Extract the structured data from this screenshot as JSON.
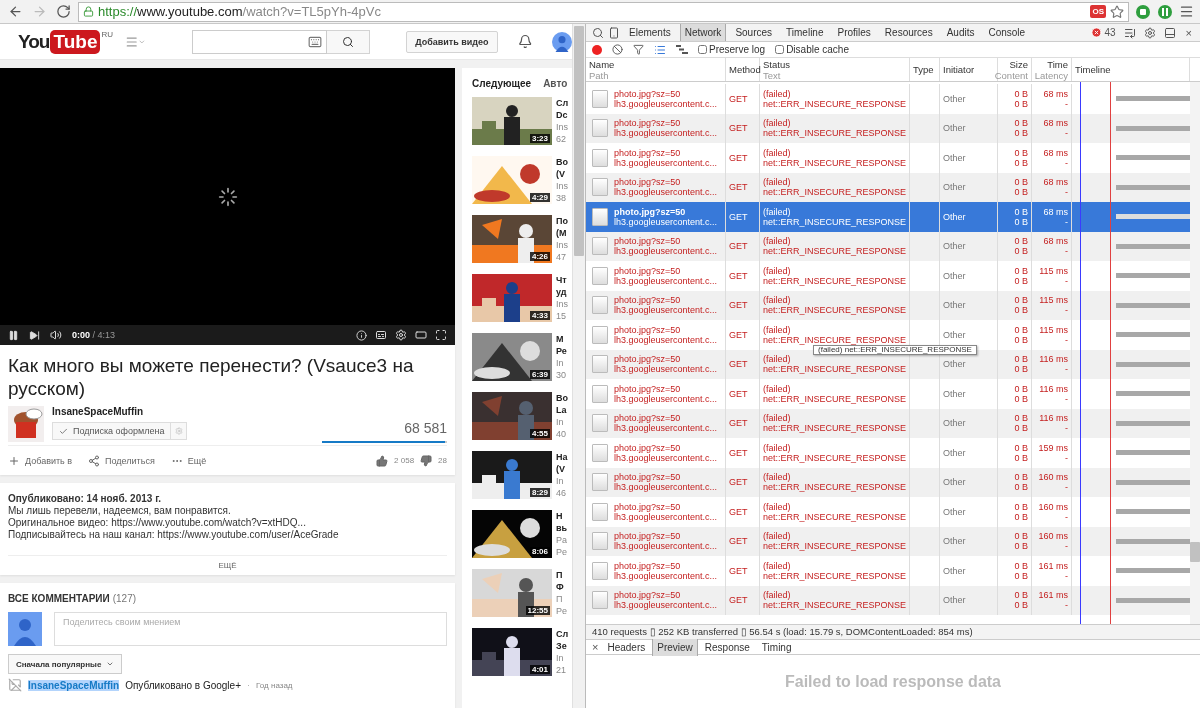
{
  "browser": {
    "nav": [
      {
        "kind": "back",
        "disabled": false
      },
      {
        "kind": "forward",
        "disabled": true
      },
      {
        "kind": "reload",
        "disabled": false
      }
    ],
    "url": {
      "scheme": "https://",
      "host": "www.youtube.com",
      "path": "/watch?v=TL5pYh-4pVc"
    },
    "extension_badge": "OS"
  },
  "youtube": {
    "logo": {
      "you": "You",
      "tube": "Tube",
      "region": "RU"
    },
    "upload_button": "Добавить видео",
    "player": {
      "loading": true,
      "time_current": "0:00",
      "time_rest": "/ 4:13"
    },
    "video": {
      "title": "Как много вы можете перенести? (Vsauce3 на русском)",
      "channel": "InsaneSpaceMuffin",
      "subscribe": {
        "label": "Подписка оформлена",
        "subscribed": true
      },
      "views": "68 581",
      "rating": {
        "level": 0.98
      },
      "actions": [
        {
          "kind": "add",
          "label": "Добавить в"
        },
        {
          "kind": "share",
          "label": "Поделиться"
        },
        {
          "kind": "more",
          "label": "Ещё"
        }
      ],
      "likes": "2 058",
      "dislikes": "28"
    },
    "description": {
      "published": "Опубликовано: 14 нояб. 2013 г.",
      "lines": [
        "Мы лишь перевели, надеемся, вам понравится.",
        "Оригинальное видео: https://www.youtube.com/watch?v=xtHDQ...",
        "Подписывайтесь на наш канал: https://www.youtube.com/user/AceGrade"
      ],
      "more": "ЕЩЁ"
    },
    "comments": {
      "heading": "ВСЕ КОММЕНТАРИИ",
      "count": "(127)",
      "placeholder": "Поделитесь своим мнением",
      "sort": "Сначала популярные",
      "items": [
        {
          "author": "InsaneSpaceMuffin",
          "author_highlighted": true,
          "source": "Опубликовано в Google+",
          "separator": "·",
          "time": "Год назад"
        }
      ]
    },
    "sidebar": {
      "heading": "Следующее",
      "autoplay": "Авто",
      "items": [
        {
          "duration": "3:23",
          "title": [
            "Сл",
            "Dc"
          ],
          "channel": "Ins",
          "views": "62"
        },
        {
          "duration": "4:29",
          "title": [
            "Во",
            "(V"
          ],
          "channel": "Ins",
          "views": "38"
        },
        {
          "duration": "4:26",
          "title": [
            "По",
            "(M"
          ],
          "channel": "Ins",
          "views": "47"
        },
        {
          "duration": "4:33",
          "title": [
            "Чт",
            "уд"
          ],
          "channel": "Ins",
          "views": "15"
        },
        {
          "duration": "6:39",
          "title": [
            "М",
            "Ре"
          ],
          "channel": "In",
          "views": "30"
        },
        {
          "duration": "4:55",
          "title": [
            "Во",
            "La"
          ],
          "channel": "In",
          "views": "40"
        },
        {
          "duration": "8:29",
          "title": [
            "На",
            "(V"
          ],
          "channel": "In",
          "views": "46"
        },
        {
          "duration": "8:06",
          "title": [
            "Н",
            "вь"
          ],
          "channel": "Pa",
          "views": "Pe"
        },
        {
          "duration": "12:55",
          "title": [
            "П",
            "Ф"
          ],
          "channel": "П",
          "views": "Pe"
        },
        {
          "duration": "4:01",
          "title": [
            "Сл",
            "Зе"
          ],
          "channel": "In",
          "views": "21"
        }
      ]
    }
  },
  "devtools": {
    "tabs": [
      {
        "label": "Elements",
        "selected": false
      },
      {
        "label": "Network",
        "selected": true
      },
      {
        "label": "Sources",
        "selected": false
      },
      {
        "label": "Timeline",
        "selected": false
      },
      {
        "label": "Profiles",
        "selected": false
      },
      {
        "label": "Resources",
        "selected": false
      },
      {
        "label": "Audits",
        "selected": false
      },
      {
        "label": "Console",
        "selected": false
      }
    ],
    "error_count": "43",
    "close": "×",
    "toolbar": {
      "recording": true,
      "list_view": true,
      "checkboxes": [
        {
          "label": "Preserve log",
          "checked": false
        },
        {
          "label": "Disable cache",
          "checked": false
        }
      ]
    },
    "columns": [
      {
        "title": "Name",
        "subtitle": "Path"
      },
      {
        "title": "Method"
      },
      {
        "title": "Status",
        "subtitle": "Text"
      },
      {
        "title": "Type"
      },
      {
        "title": "Initiator"
      },
      {
        "title": "Size",
        "subtitle": "Content"
      },
      {
        "title": "Time",
        "subtitle": "Latency"
      },
      {
        "title": "Timeline"
      }
    ],
    "rows": [
      {
        "name": "photo.jpg?sz=50",
        "path": "lh3.googleusercontent.c...",
        "method": "GET",
        "status": "(failed)",
        "status_text": "net::ERR_INSECURE_RESPONSE",
        "initiator": "Other",
        "size": "0 B",
        "content": "0 B",
        "time": "68 ms",
        "latency": "-",
        "failed": true,
        "selected": false
      },
      {
        "name": "photo.jpg?sz=50",
        "path": "lh3.googleusercontent.c...",
        "method": "GET",
        "status": "(failed)",
        "status_text": "net::ERR_INSECURE_RESPONSE",
        "initiator": "Other",
        "size": "0 B",
        "content": "0 B",
        "time": "68 ms",
        "latency": "-",
        "failed": true,
        "selected": false
      },
      {
        "name": "photo.jpg?sz=50",
        "path": "lh3.googleusercontent.c...",
        "method": "GET",
        "status": "(failed)",
        "status_text": "net::ERR_INSECURE_RESPONSE",
        "initiator": "Other",
        "size": "0 B",
        "content": "0 B",
        "time": "68 ms",
        "latency": "-",
        "failed": true,
        "selected": false
      },
      {
        "name": "photo.jpg?sz=50",
        "path": "lh3.googleusercontent.c...",
        "method": "GET",
        "status": "(failed)",
        "status_text": "net::ERR_INSECURE_RESPONSE",
        "initiator": "Other",
        "size": "0 B",
        "content": "0 B",
        "time": "68 ms",
        "latency": "-",
        "failed": true,
        "selected": false
      },
      {
        "name": "photo.jpg?sz=50",
        "path": "lh3.googleusercontent.c...",
        "method": "GET",
        "status": "(failed)",
        "status_text": "net::ERR_INSECURE_RESPONSE",
        "initiator": "Other",
        "size": "0 B",
        "content": "0 B",
        "time": "68 ms",
        "latency": "-",
        "failed": true,
        "selected": true
      },
      {
        "name": "photo.jpg?sz=50",
        "path": "lh3.googleusercontent.c...",
        "method": "GET",
        "status": "(failed)",
        "status_text": "net::ERR_INSECURE_RESPONSE",
        "initiator": "Other",
        "size": "0 B",
        "content": "0 B",
        "time": "68 ms",
        "latency": "-",
        "failed": true,
        "selected": false
      },
      {
        "name": "photo.jpg?sz=50",
        "path": "lh3.googleusercontent.c...",
        "method": "GET",
        "status": "(failed)",
        "status_text": "net::ERR_INSECURE_RESPONSE",
        "initiator": "Other",
        "size": "0 B",
        "content": "0 B",
        "time": "115 ms",
        "latency": "-",
        "failed": true,
        "selected": false
      },
      {
        "name": "photo.jpg?sz=50",
        "path": "lh3.googleusercontent.c...",
        "method": "GET",
        "status": "(failed)",
        "status_text": "net::ERR_INSECURE_RESPONSE",
        "initiator": "Other",
        "size": "0 B",
        "content": "0 B",
        "time": "115 ms",
        "latency": "-",
        "failed": true,
        "selected": false
      },
      {
        "name": "photo.jpg?sz=50",
        "path": "lh3.googleusercontent.c...",
        "method": "GET",
        "status": "(failed)",
        "status_text": "net::ERR_INSECURE_RESPONSE",
        "initiator": "Other",
        "size": "0 B",
        "content": "0 B",
        "time": "115 ms",
        "latency": "-",
        "failed": true,
        "selected": false
      },
      {
        "name": "photo.jpg?sz=50",
        "path": "lh3.googleusercontent.c...",
        "method": "GET",
        "status": "(failed)",
        "status_text": "net::ERR_INSECURE_RESPONSE",
        "initiator": "Other",
        "size": "0 B",
        "content": "0 B",
        "time": "116 ms",
        "latency": "-",
        "failed": true,
        "selected": false
      },
      {
        "name": "photo.jpg?sz=50",
        "path": "lh3.googleusercontent.c...",
        "method": "GET",
        "status": "(failed)",
        "status_text": "net::ERR_INSECURE_RESPONSE",
        "initiator": "Other",
        "size": "0 B",
        "content": "0 B",
        "time": "116 ms",
        "latency": "-",
        "failed": true,
        "selected": false
      },
      {
        "name": "photo.jpg?sz=50",
        "path": "lh3.googleusercontent.c...",
        "method": "GET",
        "status": "(failed)",
        "status_text": "net::ERR_INSECURE_RESPONSE",
        "initiator": "Other",
        "size": "0 B",
        "content": "0 B",
        "time": "116 ms",
        "latency": "-",
        "failed": true,
        "selected": false
      },
      {
        "name": "photo.jpg?sz=50",
        "path": "lh3.googleusercontent.c...",
        "method": "GET",
        "status": "(failed)",
        "status_text": "net::ERR_INSECURE_RESPONSE",
        "initiator": "Other",
        "size": "0 B",
        "content": "0 B",
        "time": "159 ms",
        "latency": "-",
        "failed": true,
        "selected": false
      },
      {
        "name": "photo.jpg?sz=50",
        "path": "lh3.googleusercontent.c...",
        "method": "GET",
        "status": "(failed)",
        "status_text": "net::ERR_INSECURE_RESPONSE",
        "initiator": "Other",
        "size": "0 B",
        "content": "0 B",
        "time": "160 ms",
        "latency": "-",
        "failed": true,
        "selected": false
      },
      {
        "name": "photo.jpg?sz=50",
        "path": "lh3.googleusercontent.c...",
        "method": "GET",
        "status": "(failed)",
        "status_text": "net::ERR_INSECURE_RESPONSE",
        "initiator": "Other",
        "size": "0 B",
        "content": "0 B",
        "time": "160 ms",
        "latency": "-",
        "failed": true,
        "selected": false
      },
      {
        "name": "photo.jpg?sz=50",
        "path": "lh3.googleusercontent.c...",
        "method": "GET",
        "status": "(failed)",
        "status_text": "net::ERR_INSECURE_RESPONSE",
        "initiator": "Other",
        "size": "0 B",
        "content": "0 B",
        "time": "160 ms",
        "latency": "-",
        "failed": true,
        "selected": false
      },
      {
        "name": "photo.jpg?sz=50",
        "path": "lh3.googleusercontent.c...",
        "method": "GET",
        "status": "(failed)",
        "status_text": "net::ERR_INSECURE_RESPONSE",
        "initiator": "Other",
        "size": "0 B",
        "content": "0 B",
        "time": "161 ms",
        "latency": "-",
        "failed": true,
        "selected": false
      },
      {
        "name": "photo.jpg?sz=50",
        "path": "lh3.googleusercontent.c...",
        "method": "GET",
        "status": "(failed)",
        "status_text": "net::ERR_INSECURE_RESPONSE",
        "initiator": "Other",
        "size": "0 B",
        "content": "0 B",
        "time": "161 ms",
        "latency": "-",
        "failed": true,
        "selected": false
      }
    ],
    "tooltip": "(failed) net::ERR_INSECURE_RESPONSE",
    "summary": "410 requests ▯ 252 KB transferred ▯ 56.54 s (load: 15.79 s, DOMContentLoaded: 854 ms)",
    "detail_close": "×",
    "detail_tabs": [
      {
        "label": "Headers",
        "selected": false
      },
      {
        "label": "Preview",
        "selected": true
      },
      {
        "label": "Response",
        "selected": false
      },
      {
        "label": "Timing",
        "selected": false
      }
    ],
    "detail_message": "Failed to load response data"
  }
}
